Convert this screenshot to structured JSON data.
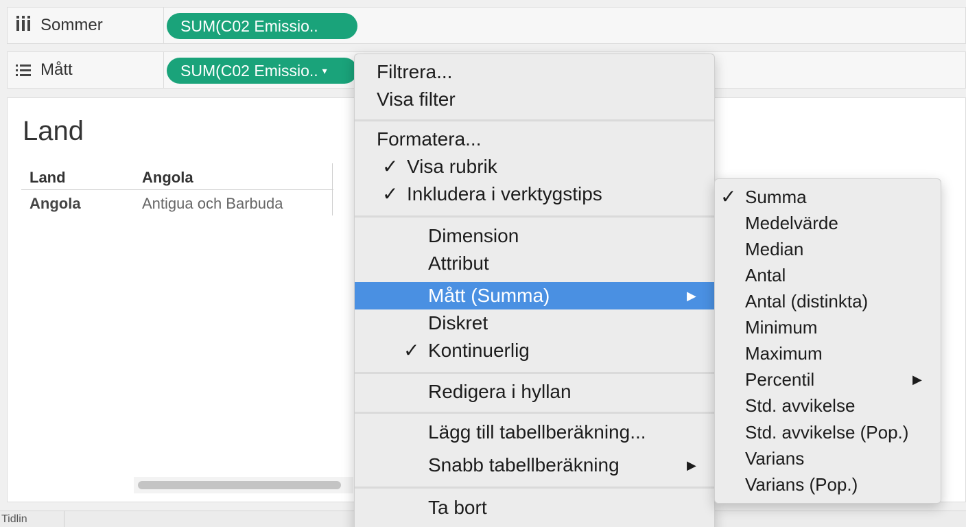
{
  "shelves": {
    "columns": {
      "label": "Sommer",
      "icon": "columns-icon",
      "pill": "SUM(C02 Emissio.."
    },
    "rows": {
      "label": "Mått",
      "icon": "rows-icon",
      "pill": "SUM(C02 Emissio..",
      "pill_caret": "▾"
    }
  },
  "sheet": {
    "title": "Land",
    "table": {
      "headers": [
        "Land",
        "Angola"
      ],
      "row": [
        "Angola",
        "Antigua och Barbuda"
      ]
    }
  },
  "bottom_tab": "Tidlin",
  "context_menu": {
    "items": [
      {
        "label": "Filtrera...",
        "checked": false,
        "submenu": false
      },
      {
        "label": "Visa filter",
        "checked": false,
        "submenu": false
      },
      {
        "label": "Formatera...",
        "checked": false,
        "submenu": false
      },
      {
        "label": "Visa rubrik",
        "checked": true,
        "submenu": false
      },
      {
        "label": "Inkludera i verktygstips",
        "checked": true,
        "submenu": false
      },
      {
        "label": "Dimension",
        "checked": false,
        "submenu": false
      },
      {
        "label": "Attribut",
        "checked": false,
        "submenu": false
      },
      {
        "label": "Mått (Summa)",
        "checked": false,
        "submenu": true,
        "highlighted": true
      },
      {
        "label": "Diskret",
        "checked": false,
        "submenu": false
      },
      {
        "label": "Kontinuerlig",
        "checked": true,
        "submenu": false
      },
      {
        "label": "Redigera i hyllan",
        "checked": false,
        "submenu": false
      },
      {
        "label": "Lägg till tabellberäkning...",
        "checked": false,
        "submenu": false
      },
      {
        "label": "Snabb tabellberäkning",
        "checked": false,
        "submenu": true
      },
      {
        "label": "Ta bort",
        "checked": false,
        "submenu": false
      }
    ],
    "check_glyph": "✓",
    "submenu_arrow": "▶",
    "highlight_color": "#4a90e2"
  },
  "measure_submenu": {
    "items": [
      {
        "label": "Summa",
        "checked": true
      },
      {
        "label": "Medelvärde"
      },
      {
        "label": "Median"
      },
      {
        "label": "Antal"
      },
      {
        "label": "Antal (distinkta)"
      },
      {
        "label": "Minimum"
      },
      {
        "label": "Maximum"
      },
      {
        "label": "Percentil",
        "submenu": true
      },
      {
        "label": "Std. avvikelse"
      },
      {
        "label": "Std. avvikelse (Pop.)"
      },
      {
        "label": "Varians"
      },
      {
        "label": "Varians (Pop.)"
      }
    ]
  },
  "colors": {
    "pill": "#1aa37a"
  }
}
